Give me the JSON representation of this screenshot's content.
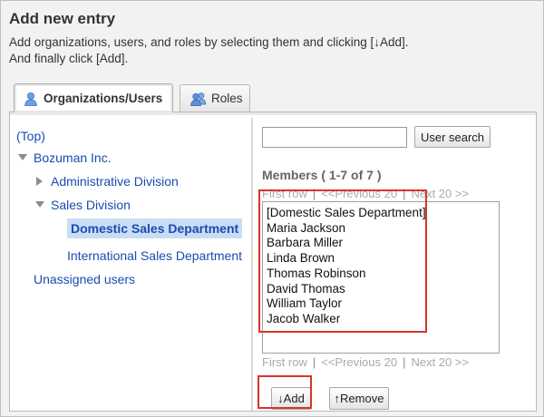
{
  "dialog": {
    "title": "Add new entry",
    "description_line1": "Add organizations, users, and roles by selecting them and clicking [↓Add].",
    "description_line2": "And finally click [Add]."
  },
  "tabs": [
    {
      "label": "Organizations/Users",
      "icon": "user-icon",
      "active": true
    },
    {
      "label": "Roles",
      "icon": "users-icon",
      "active": false
    }
  ],
  "tree": {
    "top_link": "(Top)",
    "company": "Bozuman Inc.",
    "admin_division": "Administrative Division",
    "sales_division": "Sales Division",
    "domestic_sales": "Domestic Sales Department",
    "international_sales": "International Sales Department",
    "unassigned": "Unassigned users"
  },
  "search": {
    "value": "",
    "button_label": "User search"
  },
  "members": {
    "title": "Members ( 1-7 of 7 )",
    "pager": {
      "first_row": "First row",
      "previous": "<<Previous 20",
      "next": "Next 20 >>",
      "separator": "|"
    },
    "items": [
      "[Domestic Sales Department]",
      "Maria Jackson",
      "Barbara Miller",
      "Linda Brown",
      "Thomas Robinson",
      "David Thomas",
      "William Taylor",
      "Jacob Walker"
    ]
  },
  "actions": {
    "add_label": "↓Add",
    "remove_label": "↑Remove"
  },
  "colors": {
    "link": "#1a4cb0",
    "selected_bg": "#c9ddf5",
    "highlight": "#d9342b"
  }
}
